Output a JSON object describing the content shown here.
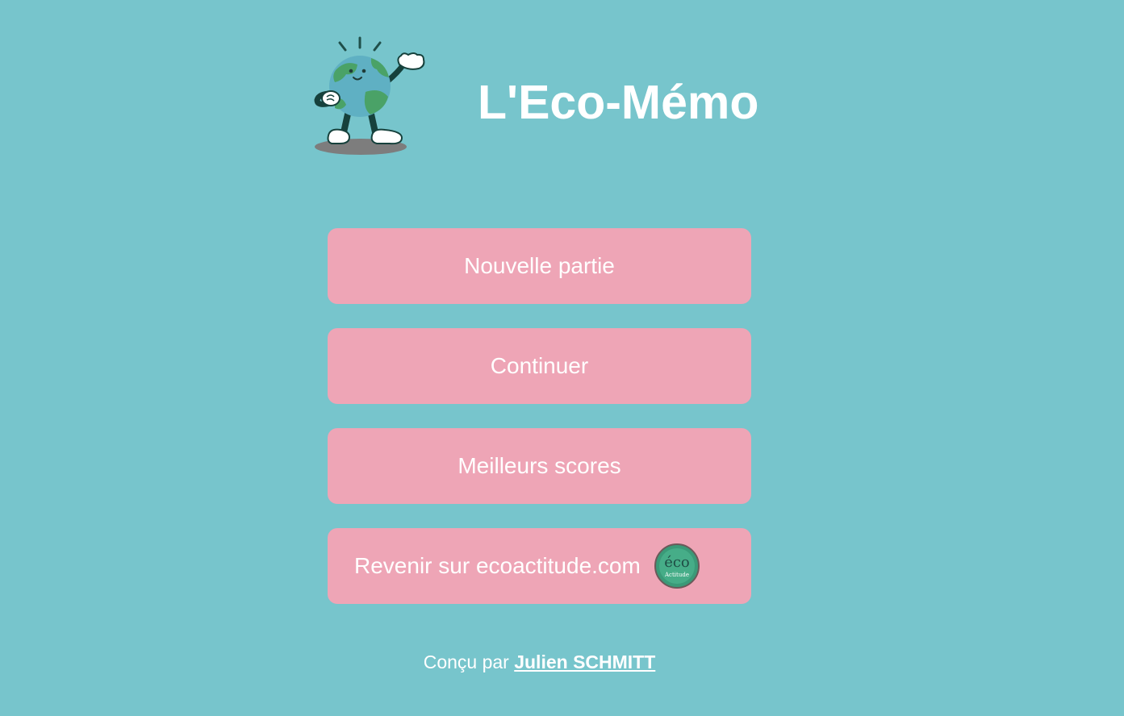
{
  "header": {
    "title": "L'Eco-Mémo",
    "mascot_icon": "earth-mascot-icon"
  },
  "menu": {
    "items": [
      {
        "label": "Nouvelle partie"
      },
      {
        "label": "Continuer"
      },
      {
        "label": "Meilleurs scores"
      },
      {
        "label": "Revenir sur ecoactitude.com",
        "icon": "eco-actitude-logo-icon",
        "logo_text": [
          "éco",
          "Actitude"
        ]
      }
    ]
  },
  "footer": {
    "prefix": "Conçu par",
    "author": "Julien SCHMITT"
  },
  "colors": {
    "background": "#77c5cc",
    "button": "#eea5b6",
    "text": "#ffffff"
  }
}
